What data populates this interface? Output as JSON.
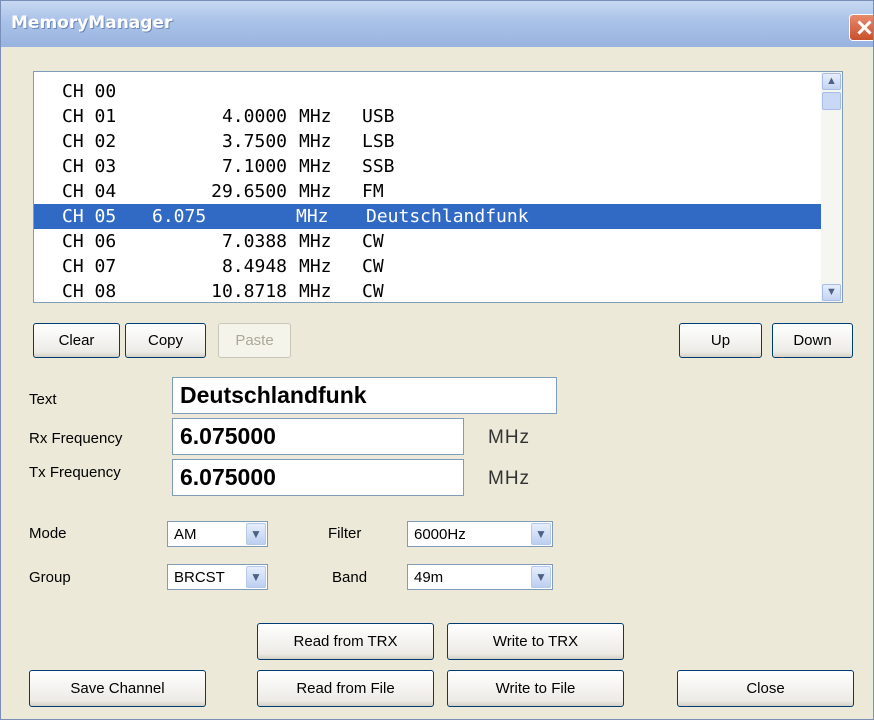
{
  "window": {
    "title": "MemoryManager"
  },
  "channels": [
    {
      "ch": "CH 00",
      "freq": "",
      "unit": "",
      "mode": ""
    },
    {
      "ch": "CH 01",
      "freq": "4.0000",
      "unit": "MHz",
      "mode": "USB"
    },
    {
      "ch": "CH 02",
      "freq": "3.7500",
      "unit": "MHz",
      "mode": "LSB"
    },
    {
      "ch": "CH 03",
      "freq": "7.1000",
      "unit": "MHz",
      "mode": "SSB"
    },
    {
      "ch": "CH 04",
      "freq": "29.6500",
      "unit": "MHz",
      "mode": "FM"
    },
    {
      "ch": "CH 05",
      "freq": "6.075",
      "unit": "MHz",
      "mode": "Deutschlandfunk",
      "selected": true
    },
    {
      "ch": "CH 06",
      "freq": "7.0388",
      "unit": "MHz",
      "mode": "CW"
    },
    {
      "ch": "CH 07",
      "freq": "8.4948",
      "unit": "MHz",
      "mode": "CW"
    },
    {
      "ch": "CH 08",
      "freq": "10.8718",
      "unit": "MHz",
      "mode": "CW"
    }
  ],
  "buttons": {
    "clear": "Clear",
    "copy": "Copy",
    "paste": "Paste",
    "up": "Up",
    "down": "Down",
    "read_trx": "Read from TRX",
    "write_trx": "Write to TRX",
    "save_channel": "Save Channel",
    "read_file": "Read from File",
    "write_file": "Write to File",
    "close": "Close"
  },
  "form": {
    "text_label": "Text",
    "text_value": "Deutschlandfunk",
    "rx_label": "Rx Frequency",
    "rx_value": "6.075000",
    "rx_unit": "MHz",
    "tx_label": "Tx Frequency",
    "tx_value": "6.075000",
    "tx_unit": "MHz",
    "mode_label": "Mode",
    "mode_value": "AM",
    "filter_label": "Filter",
    "filter_value": "6000Hz",
    "group_label": "Group",
    "group_value": "BRCST",
    "band_label": "Band",
    "band_value": "49m"
  }
}
